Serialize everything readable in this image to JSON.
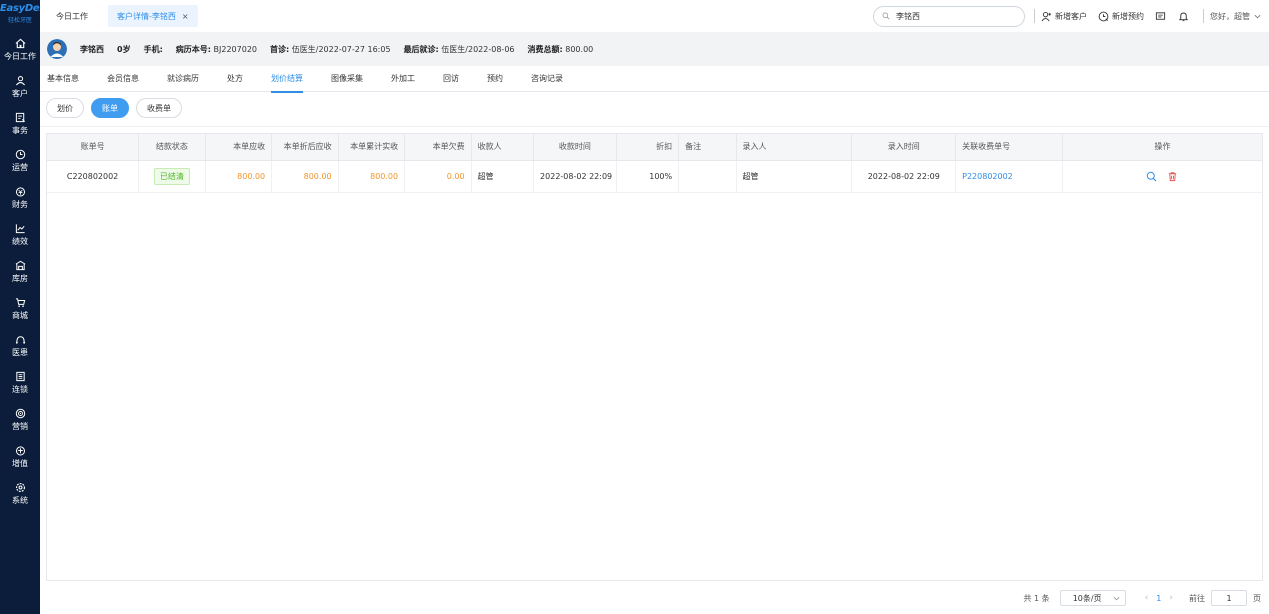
{
  "brand": {
    "name": "EasyDent",
    "sub": "轻松牙医"
  },
  "sidebar": {
    "items": [
      {
        "label": "今日工作",
        "icon": "home-icon"
      },
      {
        "label": "客户",
        "icon": "user-icon"
      },
      {
        "label": "事务",
        "icon": "task-icon"
      },
      {
        "label": "运营",
        "icon": "clock-icon"
      },
      {
        "label": "财务",
        "icon": "finance-icon"
      },
      {
        "label": "绩效",
        "icon": "chart-icon"
      },
      {
        "label": "库房",
        "icon": "warehouse-icon"
      },
      {
        "label": "商城",
        "icon": "cart-icon"
      },
      {
        "label": "医患",
        "icon": "doctor-icon"
      },
      {
        "label": "连锁",
        "icon": "chain-icon"
      },
      {
        "label": "营销",
        "icon": "marketing-icon"
      },
      {
        "label": "增值",
        "icon": "gift-icon"
      },
      {
        "label": "系统",
        "icon": "settings-icon"
      }
    ]
  },
  "topbar": {
    "home_tab": "今日工作",
    "active_tab": "客户详情-李铭西",
    "close_glyph": "×",
    "search_value": "李铭西",
    "new_customer": "新增客户",
    "new_appointment": "新增预约",
    "greeting": "您好，超管"
  },
  "patient": {
    "name": "李铭西",
    "age": "0岁",
    "phone_label": "手机:",
    "phone": "",
    "record_label": "病历本号:",
    "record_no": "BJ2207020",
    "first_visit_label": "首诊:",
    "first_visit": "伍医生/2022-07-27 16:05",
    "last_visit_label": "最后就诊:",
    "last_visit": "伍医生/2022-08-06",
    "total_label": "消费总额:",
    "total": "800.00"
  },
  "subnav": {
    "items": [
      "基本信息",
      "会员信息",
      "就诊病历",
      "处方",
      "划价结算",
      "图像采集",
      "外加工",
      "回访",
      "预约",
      "咨询记录"
    ],
    "active_index": 4
  },
  "pills": {
    "items": [
      "划价",
      "账单",
      "收费单"
    ],
    "active_index": 1
  },
  "table": {
    "headers": [
      "账单号",
      "结款状态",
      "本单应收",
      "本单折后应收",
      "本单累计实收",
      "本单欠费",
      "收款人",
      "收款时间",
      "折扣",
      "备注",
      "录入人",
      "录入时间",
      "关联收费单号",
      "操作"
    ],
    "rows": [
      {
        "bill_no": "C220802002",
        "status": "已结清",
        "receivable": "800.00",
        "discounted": "800.00",
        "received": "800.00",
        "arrears": "0.00",
        "payee": "超管",
        "pay_time": "2022-08-02 22:09",
        "discount": "100%",
        "remark": "",
        "entered_by": "超管",
        "entry_time": "2022-08-02 22:09",
        "related_no": "P220802002"
      }
    ]
  },
  "pager": {
    "total": "共 1 条",
    "page_size": "10条/页",
    "prev": "‹",
    "current": "1",
    "next": "›",
    "goto_label": "前往",
    "goto_value": "1",
    "page_suffix": "页"
  },
  "colors": {
    "sidebar_bg": "#0b1d3a",
    "accent": "#2f8ee8",
    "amount_orange": "#f0952c",
    "paid_green": "#52b42a",
    "delete_red": "#e8504f"
  }
}
